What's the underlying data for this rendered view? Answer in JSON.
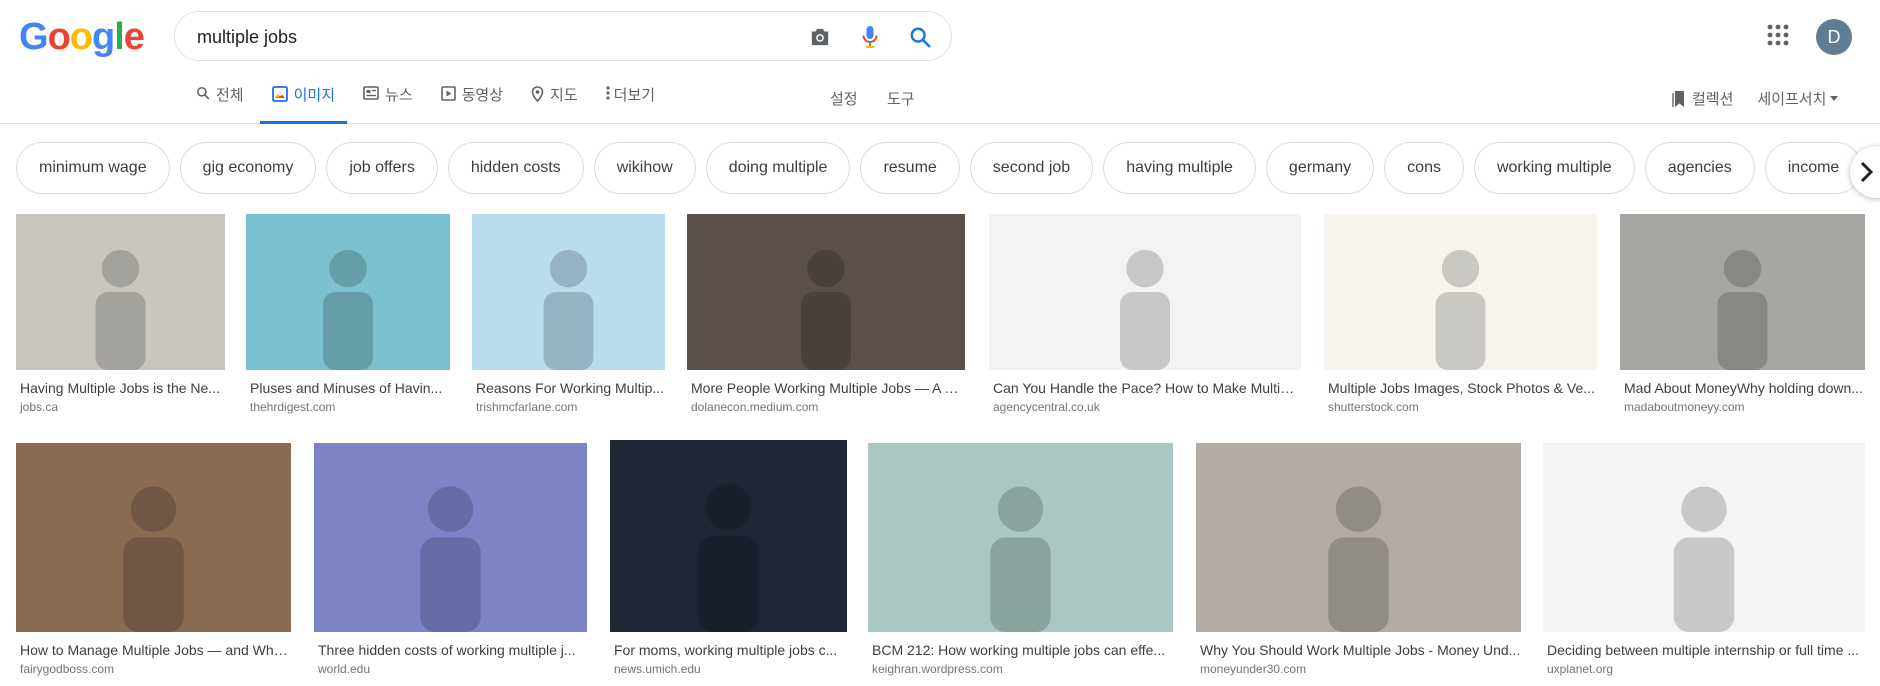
{
  "search": {
    "query": "multiple jobs"
  },
  "logo": {
    "letters": [
      "G",
      "o",
      "o",
      "g",
      "l",
      "e"
    ],
    "colors": [
      "#4285f4",
      "#ea4335",
      "#fbbc05",
      "#4285f4",
      "#34a853",
      "#ea4335"
    ]
  },
  "avatar": {
    "initial": "D",
    "color": "#5f7d95"
  },
  "tabs": [
    {
      "label": "전체",
      "icon": "search-icon"
    },
    {
      "label": "이미지",
      "icon": "image-icon",
      "active": true
    },
    {
      "label": "뉴스",
      "icon": "news-icon"
    },
    {
      "label": "동영상",
      "icon": "video-icon"
    },
    {
      "label": "지도",
      "icon": "map-pin-icon"
    },
    {
      "label": "더보기",
      "icon": "more-vert-icon"
    }
  ],
  "tools": {
    "settings": "설정",
    "tools": "도구",
    "collections": "컬렉션",
    "safesearch": "세이프서치"
  },
  "chips": [
    "minimum wage",
    "gig economy",
    "job offers",
    "hidden costs",
    "wikihow",
    "doing multiple",
    "resume",
    "second job",
    "having multiple",
    "germany",
    "cons",
    "working multiple",
    "agencies",
    "income"
  ],
  "results": [
    {
      "title": "Having Multiple Jobs is the Ne...",
      "source": "jobs.ca",
      "bg": "#c9c6c0"
    },
    {
      "title": "Pluses and Minuses of Havin...",
      "source": "thehrdigest.com",
      "bg": "#7cc1cf"
    },
    {
      "title": "Reasons For Working Multip...",
      "source": "trishmcfarlane.com",
      "bg": "#b9dcef"
    },
    {
      "title": "More People Working Multiple Jobs — A G...",
      "source": "dolanecon.medium.com",
      "bg": "#5a5049"
    },
    {
      "title": "Can You Handle the Pace? How to Make Multipl...",
      "source": "agencycentral.co.uk",
      "bg": "#f3f3f3"
    },
    {
      "title": "Multiple Jobs Images, Stock Photos & Ve...",
      "source": "shutterstock.com",
      "bg": "#f7f4ee"
    },
    {
      "title": "Mad About MoneyWhy holding down...",
      "source": "madaboutmoneyy.com",
      "bg": "#a8a6a3"
    },
    {
      "title": "How to Manage Multiple Jobs — and Why...",
      "source": "fairygodboss.com",
      "bg": "#8a6b52"
    },
    {
      "title": "Three hidden costs of working multiple j...",
      "source": "world.edu",
      "bg": "#7d83c7"
    },
    {
      "title": "For moms, working multiple jobs c...",
      "source": "news.umich.edu",
      "bg": "#1f2735"
    },
    {
      "title": "BCM 212: How working multiple jobs can effe...",
      "source": "keighran.wordpress.com",
      "bg": "#a9c8c3"
    },
    {
      "title": "Why You Should Work Multiple Jobs - Money Und...",
      "source": "moneyunder30.com",
      "bg": "#b2aba4"
    },
    {
      "title": "Deciding between multiple internship or full time ...",
      "source": "uxplanet.org",
      "bg": "#f4f4f2"
    }
  ]
}
